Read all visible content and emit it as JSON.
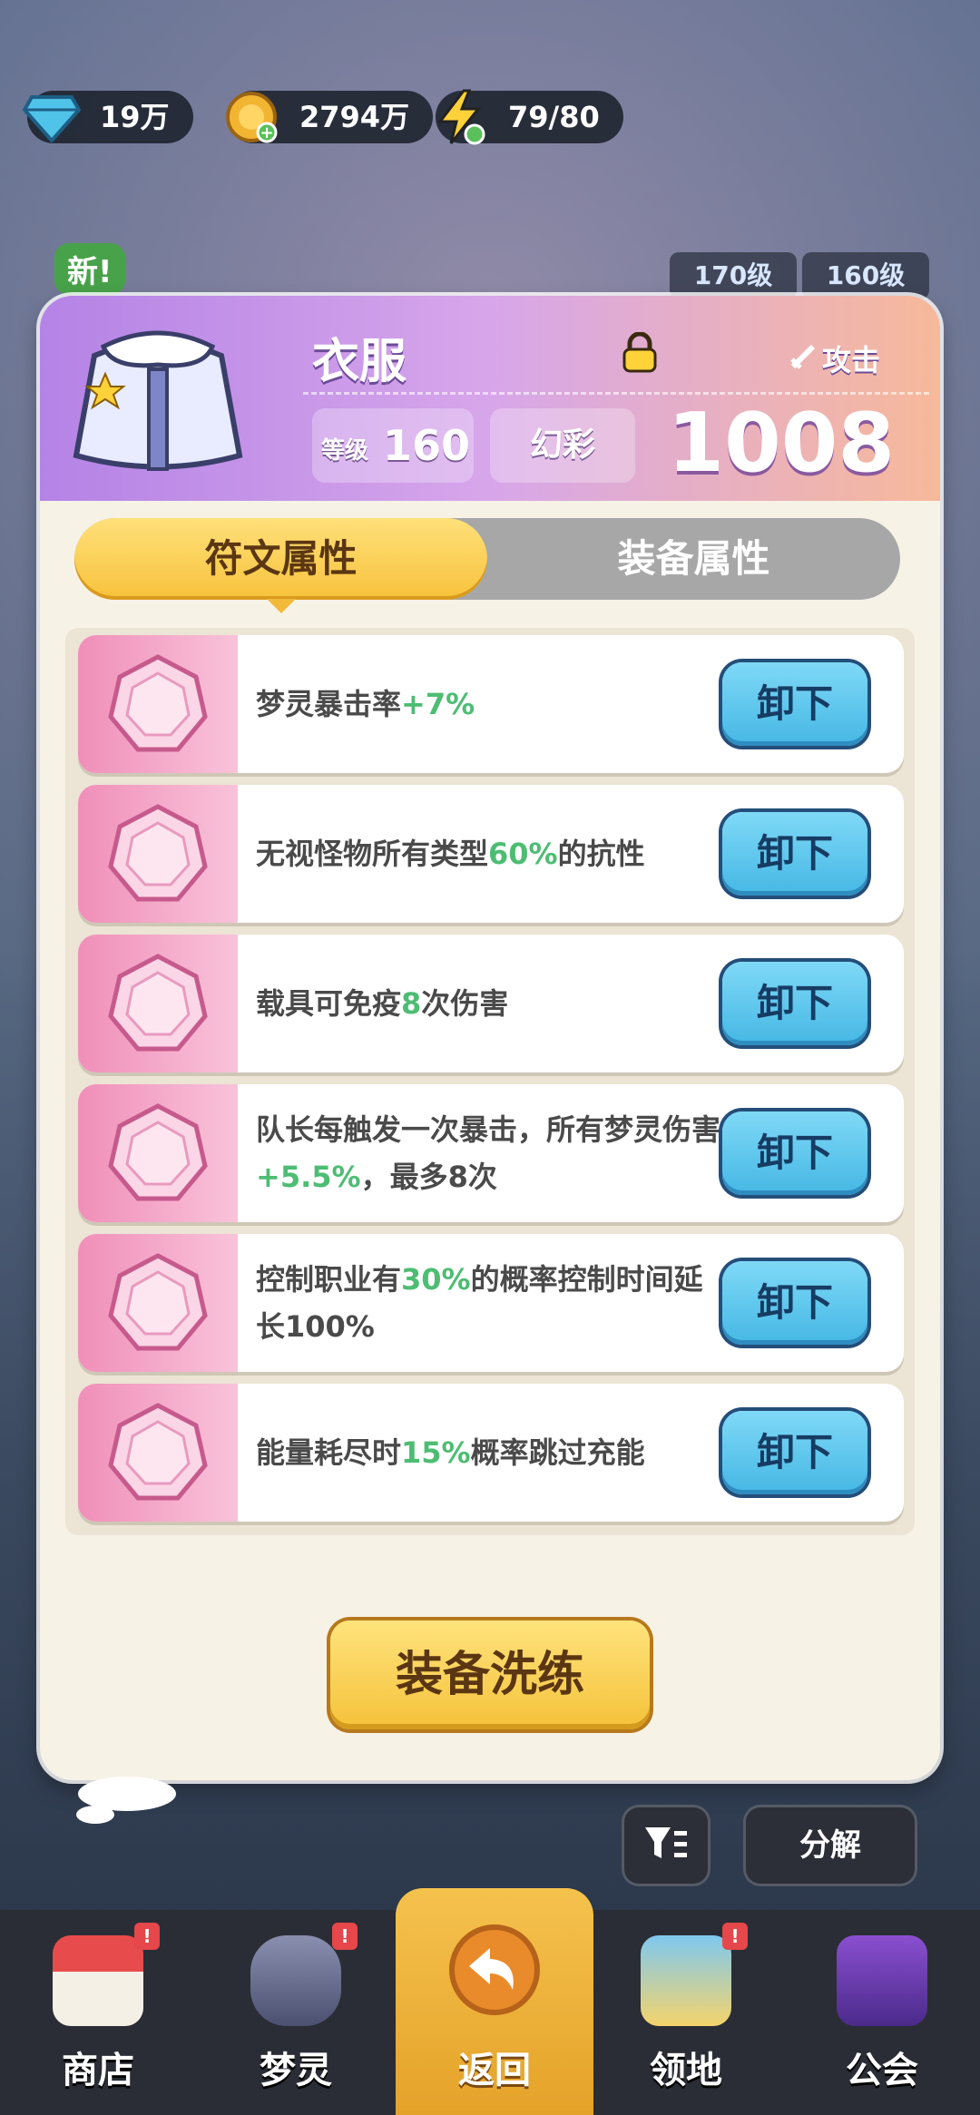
{
  "resources": [
    {
      "icon": "diamond-icon",
      "value": "19万"
    },
    {
      "icon": "coin-icon",
      "value": "2794万"
    },
    {
      "icon": "energy-icon",
      "value": "79/80"
    }
  ],
  "background": {
    "new_badge": "新!",
    "level_tags": [
      "170级",
      "160级"
    ]
  },
  "panel": {
    "title": "衣服",
    "stat_type": "攻击",
    "level_label": "等级",
    "level_value": "160",
    "quality": "幻彩",
    "power": "1008",
    "tabs": [
      {
        "label": "符文属性",
        "active": true
      },
      {
        "label": "装备属性",
        "active": false
      }
    ],
    "runes": [
      {
        "parts": [
          {
            "t": "梦灵暴击率"
          },
          {
            "t": "+7%",
            "g": true
          }
        ]
      },
      {
        "parts": [
          {
            "t": "无视怪物所有类型"
          },
          {
            "t": "60%",
            "g": true
          },
          {
            "t": "的抗性"
          }
        ]
      },
      {
        "parts": [
          {
            "t": "载具可免疫"
          },
          {
            "t": "8",
            "g": true
          },
          {
            "t": "次伤害"
          }
        ]
      },
      {
        "parts": [
          {
            "t": "队长每触发一次暴击，所有梦灵伤害"
          },
          {
            "t": "+5.5%",
            "g": true
          },
          {
            "t": "，最多8次"
          }
        ]
      },
      {
        "parts": [
          {
            "t": "控制职业有"
          },
          {
            "t": "30%",
            "g": true
          },
          {
            "t": "的概率控制时间延长100%"
          }
        ]
      },
      {
        "parts": [
          {
            "t": "能量耗尽时"
          },
          {
            "t": "15%",
            "g": true
          },
          {
            "t": "概率跳过充能"
          }
        ]
      }
    ],
    "unequip_label": "卸下",
    "reforge_label": "装备洗练"
  },
  "decompose_label": "分解",
  "nav": [
    {
      "label": "商店",
      "icon": "shop-icon",
      "alert": true
    },
    {
      "label": "梦灵",
      "icon": "spirit-icon",
      "alert": true
    },
    {
      "label": "返回",
      "icon": "return-icon",
      "alert": false,
      "active": true
    },
    {
      "label": "领地",
      "icon": "territory-icon",
      "alert": true
    },
    {
      "label": "公会",
      "icon": "guild-icon",
      "alert": false
    }
  ],
  "colors": {
    "accent_green": "#4dbd73",
    "button_blue": "#45b7e4",
    "gold": "#f5c23a",
    "panel_bg": "#f7f2e6"
  }
}
